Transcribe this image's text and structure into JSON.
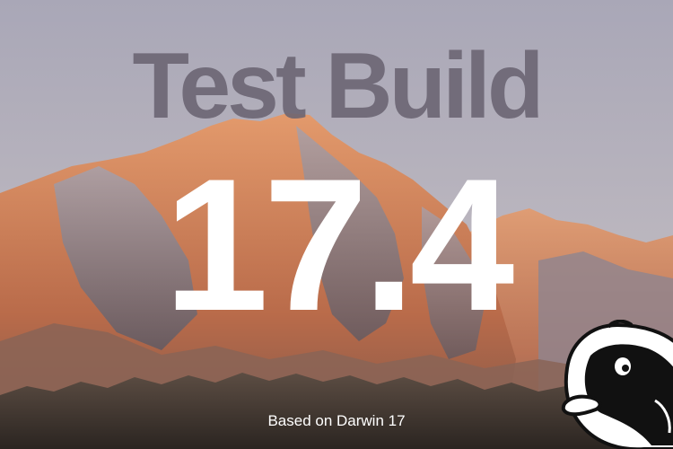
{
  "title": "Test Build",
  "version": "17.4",
  "caption": "Based on Darwin 17",
  "colors": {
    "sky_top": "#a8a6b6",
    "sky_bottom": "#c9c3c6",
    "title": "#6a6472",
    "version": "#ffffff",
    "mountain_lit": "#c9784f",
    "mountain_shadow": "#6f6872",
    "boulders": "#3d3631"
  },
  "icons": {
    "mascot": "puffin-mascot-icon"
  }
}
